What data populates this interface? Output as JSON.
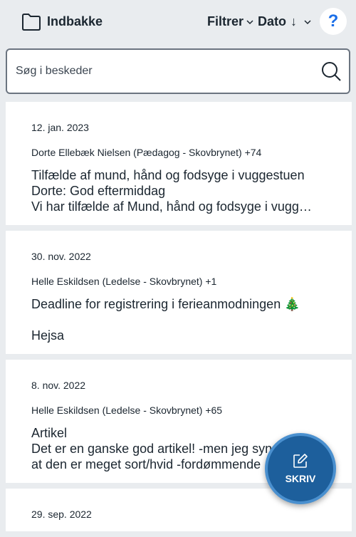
{
  "header": {
    "title": "Indbakke",
    "filter_label": "Filtrer",
    "sort_label": "Dato",
    "sort_direction": "↓",
    "help_label": "?"
  },
  "search": {
    "placeholder": "Søg i beskeder"
  },
  "messages": [
    {
      "date": "12. jan. 2023",
      "sender": "Dorte Ellebæk Nielsen (Pædagog - Skovbrynet) +74",
      "subject": "Tilfælde af mund, hånd og fodsyge i vuggestuen",
      "preview_1": "Dorte: God eftermiddag",
      "preview_2": "Vi har tilfælde af Mund, hånd og fodsyge i vugg…"
    },
    {
      "date": "30. nov. 2022",
      "sender": "Helle Eskildsen (Ledelse - Skovbrynet) +1",
      "subject": "Deadline for registrering i ferieanmodningen",
      "subject_emoji": "🎄",
      "preview_1": "Hejsa"
    },
    {
      "date": "8. nov. 2022",
      "sender": "Helle Eskildsen (Ledelse - Skovbrynet) +65",
      "subject": "Artikel",
      "preview_1": "Det er en ganske god artikel! -men jeg synes",
      "preview_2": "at den er meget sort/hvid -fordømmende"
    },
    {
      "date": "29. sep. 2022"
    }
  ],
  "compose": {
    "label": "SKRIV"
  },
  "colors": {
    "background": "#e9ecef",
    "help_accent": "#1a6ee8",
    "fab": "#1d5f9c",
    "fab_ring": "#4a90cf"
  }
}
